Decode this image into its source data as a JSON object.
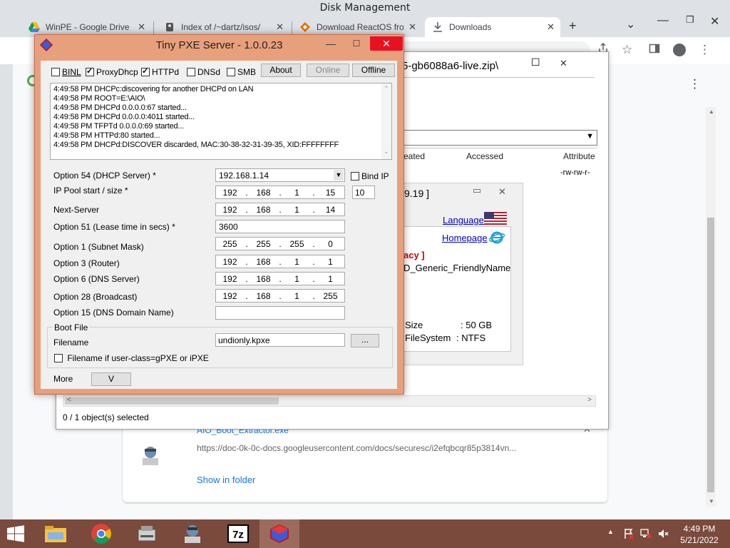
{
  "disk_management_title": "Disk Management",
  "browser": {
    "tabs": [
      {
        "label": "WinPE - Google Drive",
        "icon": "google-drive-icon"
      },
      {
        "label": "Index of /~dartz/isos/",
        "icon": "server-icon"
      },
      {
        "label": "Download ReactOS fro",
        "icon": "reactos-icon"
      },
      {
        "label": "Downloads",
        "icon": "download-icon"
      }
    ],
    "new_tab": "+",
    "tab_close": "✕",
    "tab_dropdown": "⌄",
    "min": "—",
    "max": "❐",
    "close": "✕",
    "star": "☆",
    "menu": "⋮"
  },
  "downloads": {
    "file_name": "AIO_Boot_Extractor.exe",
    "file_url": "https://doc-0k-0c-docs.googleusercontent.com/docs/securesc/i2efqbcqr85p3814vn...",
    "show_in_folder": "Show in folder",
    "close_item": "✕"
  },
  "explorer": {
    "path": "5-gb6088a6-live.zip\\",
    "min": "☐",
    "close": "✕",
    "columns": [
      "eated",
      "Accessed",
      "Attribute"
    ],
    "row_attr": "-rw-rw-r-",
    "status": "0 / 1 object(s) selected",
    "scroll_left": "<",
    "scroll_right": ">"
  },
  "inner_dialog": {
    "title": "9.19 ]",
    "min": "▭",
    "close": "✕",
    "language": "Language",
    "homepage": "Homepage",
    "legacy": "acy ]",
    "friendly": "D_Generic_FriendlyName",
    "size_label": "Size",
    "size_value": ": 50 GB",
    "fs_label": "FileSystem",
    "fs_value": ": NTFS"
  },
  "pxe": {
    "title": "Tiny PXE Server - 1.0.0.23",
    "min": "—",
    "max": "☐",
    "close": "✕",
    "checks": [
      {
        "label": "BINL",
        "checked": false
      },
      {
        "label": "ProxyDhcp",
        "checked": true
      },
      {
        "label": "HTTPd",
        "checked": true
      },
      {
        "label": "DNSd",
        "checked": false
      },
      {
        "label": "SMB",
        "checked": false
      }
    ],
    "about": "About",
    "online": "Online",
    "offline": "Offline",
    "log": [
      "4:49:58 PM DHCPc:discovering for another DHCPd on LAN",
      "4:49:58 PM ROOT=E:\\AIO\\",
      "4:49:58 PM DHCPd 0.0.0.0:67 started...",
      "4:49:58 PM DHCPd 0.0.0.0:4011 started...",
      "4:49:58 PM TFPTd 0.0.0.0:69 started...",
      "4:49:58 PM HTTPd:80 started...",
      "4:49:58 PM DHCPd:DISCOVER discarded, MAC:30-38-32-31-39-35, XID:FFFFFFFF"
    ],
    "opt54_label": "Option 54 (DHCP Server) *",
    "opt54_value": "192.168.1.14",
    "bind_ip": "Bind IP",
    "pool_label": "IP Pool start / size *",
    "pool_ip": [
      "192",
      "168",
      "1",
      "15"
    ],
    "pool_size": "10",
    "next_label": "Next-Server",
    "next_ip": [
      "192",
      "168",
      "1",
      "14"
    ],
    "opt51_label": "Option 51 (Lease time in secs) *",
    "opt51_value": "3600",
    "opt1_label": "Option 1  (Subnet Mask)",
    "opt1_ip": [
      "255",
      "255",
      "255",
      "0"
    ],
    "opt3_label": "Option 3  (Router)",
    "opt3_ip": [
      "192",
      "168",
      "1",
      "1"
    ],
    "opt6_label": "Option 6  (DNS Server)",
    "opt6_ip": [
      "192",
      "168",
      "1",
      "1"
    ],
    "opt28_label": "Option 28 (Broadcast)",
    "opt28_ip": [
      "192",
      "168",
      "1",
      "255"
    ],
    "opt15_label": "Option 15 (DNS Domain Name)",
    "opt15_value": "",
    "bootfile_group": "Boot File",
    "filename_label": "Filename",
    "filename_value": "undionly.kpxe",
    "browse": "...",
    "ipxe_check": "Filename if user-class=gPXE or iPXE",
    "more": "More",
    "more_btn": "V"
  },
  "taskbar": {
    "time": "4:49 PM",
    "date": "5/21/2022",
    "apps": [
      "file-explorer-icon",
      "chrome-icon",
      "disk-tool-icon",
      "user-tool-icon",
      "7zip-icon",
      "tiny-pxe-icon"
    ]
  }
}
